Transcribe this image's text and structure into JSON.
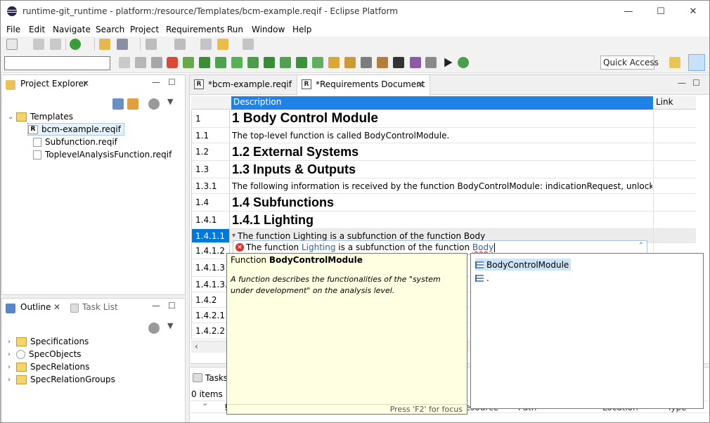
{
  "window": {
    "title": "runtime-git_runtime - platform:/resource/Templates/bcm-example.reqif - Eclipse Platform",
    "minimize": "—",
    "maximize": "☐",
    "close": "✕"
  },
  "menu": [
    "File",
    "Edit",
    "Navigate",
    "Search",
    "Project",
    "Requirements",
    "Run",
    "Window",
    "Help"
  ],
  "toolbar": {
    "quick_access": "Quick Access"
  },
  "project_explorer": {
    "tab_label": "Project Explorer",
    "tree": [
      {
        "label": "Templates",
        "kind": "folder"
      },
      {
        "label": "bcm-example.reqif",
        "kind": "reqif",
        "selected": true
      },
      {
        "label": "Subfunction.reqif",
        "kind": "file"
      },
      {
        "label": "ToplevelAnalysisFunction.reqif",
        "kind": "file"
      }
    ]
  },
  "outline": {
    "tab_label": "Outline",
    "tab2_label": "Task List",
    "tree": [
      "Specifications",
      "SpecObjects",
      "SpecRelations",
      "SpecRelationGroups"
    ]
  },
  "editor": {
    "tabs": [
      {
        "label": "*bcm-example.reqif",
        "active": false
      },
      {
        "label": "*Requirements Document",
        "active": true
      }
    ],
    "columns": [
      "Description",
      "Link"
    ],
    "rows": [
      {
        "num": "1",
        "text": "1 Body Control Module",
        "style": "h1"
      },
      {
        "num": "1.1",
        "text": "The top-level function is called BodyControlModule.",
        "style": "txt"
      },
      {
        "num": "1.2",
        "text": "1.2 External Systems",
        "style": "h2"
      },
      {
        "num": "1.3",
        "text": "1.3 Inputs & Outputs",
        "style": "h2"
      },
      {
        "num": "1.3.1",
        "text": "The following information is received by the function BodyControlModule: indicationRequest, unlockRequest.",
        "style": "txt"
      },
      {
        "num": "1.4",
        "text": "1.4 Subfunctions",
        "style": "h2"
      },
      {
        "num": "1.4.1",
        "text": "1.4.1 Lighting",
        "style": "h2"
      },
      {
        "num": "1.4.1.1",
        "text": "The function Lighting is a subfunction of the function Body",
        "style": "txt",
        "selected": true
      },
      {
        "num": "1.4.1.2",
        "text": "",
        "style": "txt"
      },
      {
        "num": "1.4.1.3",
        "text": "",
        "style": "txt"
      },
      {
        "num": "1.4.1.3.1",
        "text": "",
        "style": "txt"
      },
      {
        "num": "1.4.2",
        "text": "",
        "style": "txt"
      },
      {
        "num": "1.4.2.1",
        "text": "",
        "style": "txt"
      },
      {
        "num": "1.4.2.2",
        "text": "",
        "style": "txt"
      }
    ],
    "edit_box": {
      "prefix": "The function ",
      "link1": "Lighting",
      "middle": " is a subfunction of the function ",
      "link2": "Body"
    }
  },
  "info_popup": {
    "title_prefix": "Function ",
    "title_bold": "BodyControlModule",
    "body": "A function describes the functionalities of the \"system under development\" on the analysis level.",
    "footer": "Press 'F2' for focus"
  },
  "proposals": [
    {
      "label": "BodyControlModule",
      "selected": true
    },
    {
      "label": ".",
      "selected": false
    }
  ],
  "tasks_view": {
    "tab_label": "Tasks",
    "count": "0 items",
    "columns": [
      "!",
      "Resource",
      "Path",
      "Location",
      "Type"
    ]
  },
  "colors": {
    "selection": "#0078d7",
    "header_selected": "#1e82e6",
    "tooltip_bg": "#ffffe1",
    "link": "#2f5fa7"
  }
}
